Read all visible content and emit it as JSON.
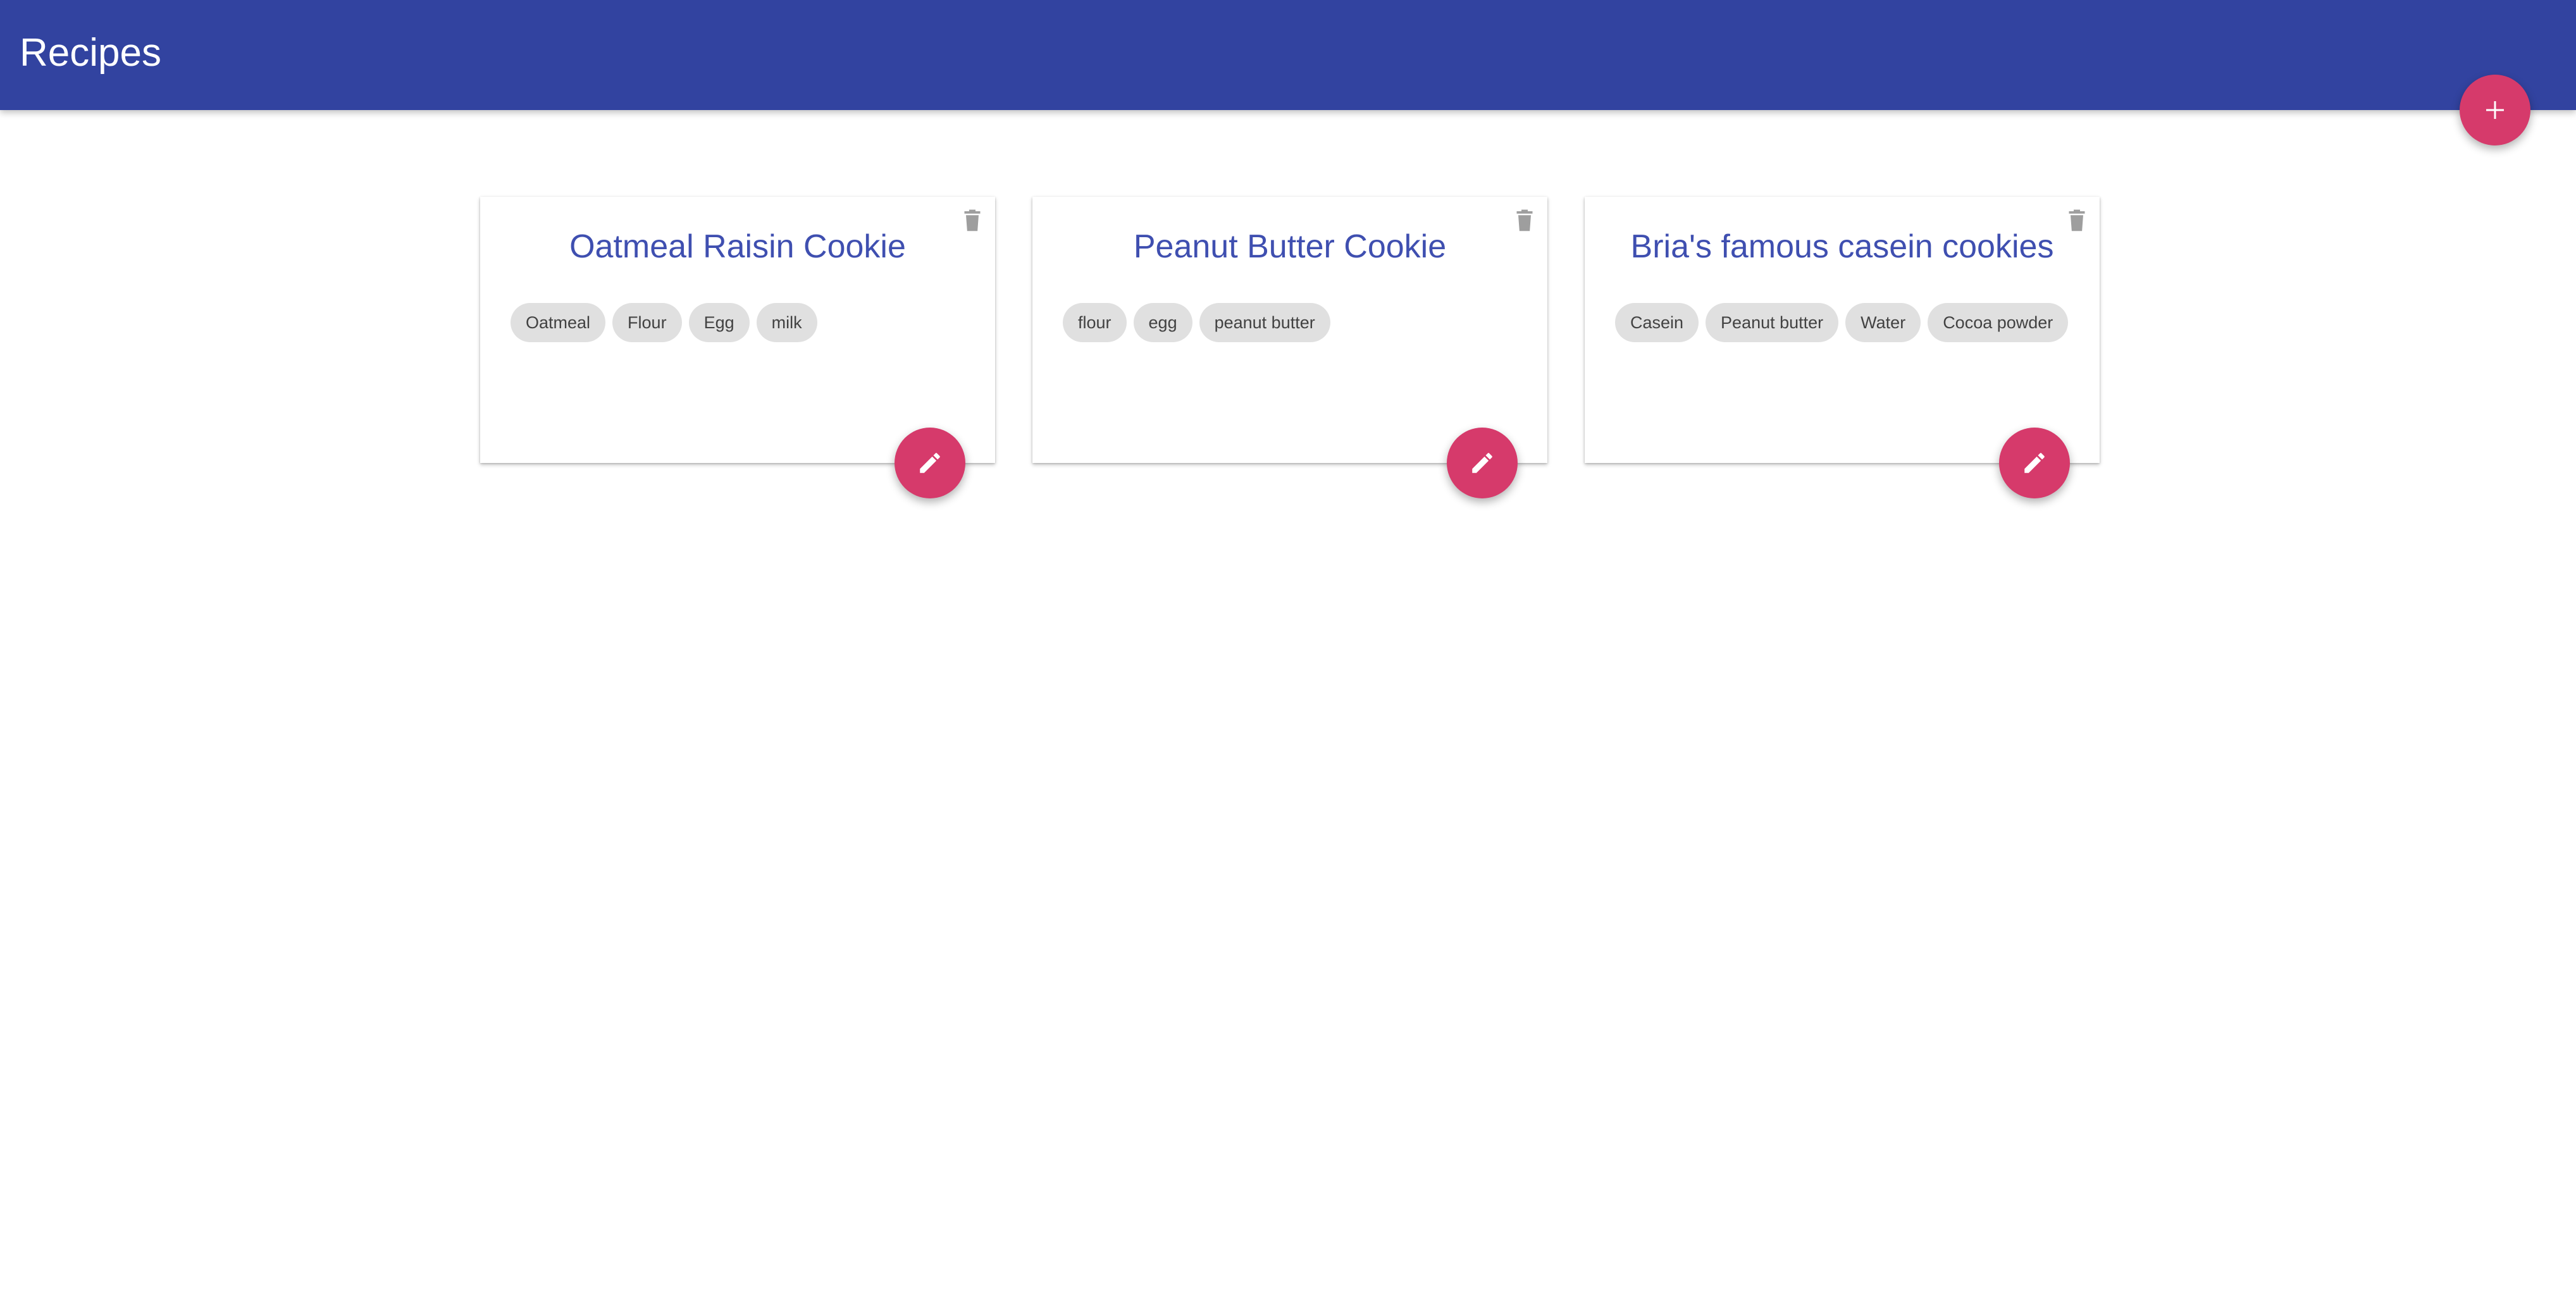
{
  "app_bar": {
    "title": "Recipes",
    "background_color": "#3243a0",
    "add_button_icon": "plus-icon"
  },
  "colors": {
    "accent": "#d63a6b",
    "title_text": "#3f4fb0",
    "chip_background": "#e0e0e0"
  },
  "recipes": [
    {
      "title": "Oatmeal Raisin Cookie",
      "ingredients": [
        "Oatmeal",
        "Flour",
        "Egg",
        "milk"
      ],
      "delete_icon": "trash-icon",
      "edit_icon": "pencil-icon"
    },
    {
      "title": "Peanut Butter Cookie",
      "ingredients": [
        "flour",
        "egg",
        "peanut butter"
      ],
      "delete_icon": "trash-icon",
      "edit_icon": "pencil-icon"
    },
    {
      "title": "Bria's famous casein cookies",
      "ingredients": [
        "Casein",
        "Peanut butter",
        "Water",
        "Cocoa powder"
      ],
      "delete_icon": "trash-icon",
      "edit_icon": "pencil-icon"
    }
  ]
}
